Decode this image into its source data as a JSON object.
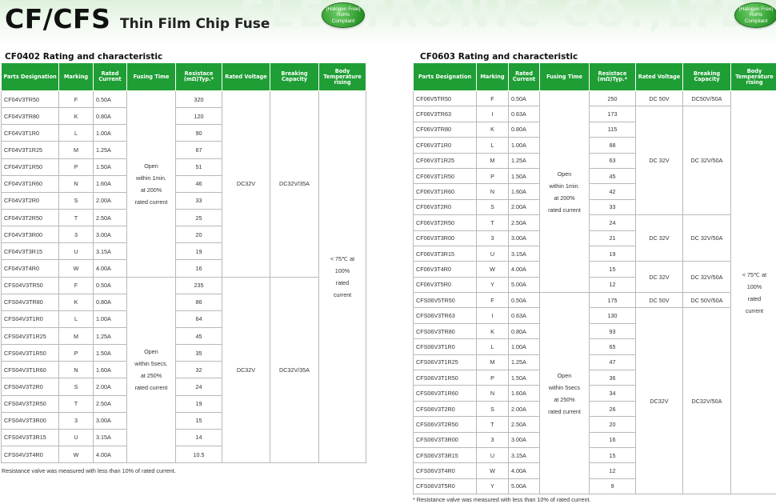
{
  "header": {
    "series": "CF/CFS",
    "subtitle": "Thin Film Chip Fuse",
    "watermark": "ELECTRONIC CO.,LTD",
    "badge": [
      "(Halogen Free)",
      "RoHs",
      "Compliant"
    ]
  },
  "columns": [
    "Parts Designation",
    "Marking",
    "Rated Current",
    "Fusing Time",
    "Resistace (mΩ)Typ.*",
    "Rated Voltage",
    "Breaking Capacity",
    "Body Temperature rising"
  ],
  "left": {
    "title": "CF0402 Rating and characteristic",
    "rows": [
      [
        "CF04V3TR50",
        "F",
        "0.50A",
        "320"
      ],
      [
        "CF04V3TR80",
        "K",
        "0.80A",
        "120"
      ],
      [
        "CF04V3T1R0",
        "L",
        "1.00A",
        "90"
      ],
      [
        "CF04V3T1R25",
        "M",
        "1.25A",
        "67"
      ],
      [
        "CF04V3T1R50",
        "P",
        "1.50A",
        "51"
      ],
      [
        "CF04V3T1R60",
        "N",
        "1.60A",
        "46"
      ],
      [
        "CF04V3T2R0",
        "S",
        "2.00A",
        "33"
      ],
      [
        "CF04V3T2R50",
        "T",
        "2.50A",
        "25"
      ],
      [
        "CF04V3T3R00",
        "3",
        "3.00A",
        "20"
      ],
      [
        "CF04V3T3R15",
        "U",
        "3.15A",
        "19"
      ],
      [
        "CF04V3T4R0",
        "W",
        "4.00A",
        "16"
      ],
      [
        "CFS04V3TR50",
        "F",
        "0.50A",
        "235"
      ],
      [
        "CFS04V3TR80",
        "K",
        "0.80A",
        "86"
      ],
      [
        "CFS04V3T1R0",
        "L",
        "1.00A",
        "64"
      ],
      [
        "CFS04V3T1R25",
        "M",
        "1.25A",
        "45"
      ],
      [
        "CFS04V3T1R50",
        "P",
        "1.50A",
        "35"
      ],
      [
        "CFS04V3T1R60",
        "N",
        "1.60A",
        "32"
      ],
      [
        "CFS04V3T2R0",
        "S",
        "2.00A",
        "24"
      ],
      [
        "CFS04V3T2R50",
        "T",
        "2.50A",
        "19"
      ],
      [
        "CFS04V3T3R00",
        "3",
        "3.00A",
        "15"
      ],
      [
        "CFS04V3T3R15",
        "U",
        "3.15A",
        "14"
      ],
      [
        "CFS04V3T4R0",
        "W",
        "4.00A",
        "10.5"
      ]
    ],
    "fusing_cf": [
      "Open",
      "within 1min.",
      "at 200%",
      "rated current"
    ],
    "fusing_cfs": [
      "Open",
      "within 5secs.",
      "at 250%",
      "rated current"
    ],
    "voltage_cf": "DC32V",
    "breaking_cf": "DC32V/35A",
    "voltage_cfs": "DC32V",
    "breaking_cfs": "DC32V/35A",
    "temperature": [
      "< 75℃ at",
      "100%",
      "rated",
      "current"
    ],
    "note": "Resistance valve was measured with less than 10% of rated current."
  },
  "right": {
    "title": "CF0603 Rating and characteristic",
    "rows": [
      [
        "CF06V5TR50",
        "F",
        "0.50A",
        "250"
      ],
      [
        "CF06V3TR63",
        "I",
        "0.63A",
        "173"
      ],
      [
        "CF06V3TR80",
        "K",
        "0.80A",
        "115"
      ],
      [
        "CF06V3T1R0",
        "L",
        "1.00A",
        "88"
      ],
      [
        "CF06V3T1R25",
        "M",
        "1.25A",
        "63"
      ],
      [
        "CF06V3T1R50",
        "P",
        "1.50A",
        "45"
      ],
      [
        "CF06V3T1R60",
        "N",
        "1.60A",
        "42"
      ],
      [
        "CF06V3T2R0",
        "S",
        "2.00A",
        "33"
      ],
      [
        "CF06V3T2R50",
        "T",
        "2.50A",
        "24"
      ],
      [
        "CF06V3T3R00",
        "3",
        "3.00A",
        "21"
      ],
      [
        "CF06V3T3R15",
        "U",
        "3.15A",
        "19"
      ],
      [
        "CF06V3T4R0",
        "W",
        "4.00A",
        "15"
      ],
      [
        "CF06V3T5R0",
        "Y",
        "5.00A",
        "12"
      ],
      [
        "CFS06V5TR50",
        "F",
        "0.50A",
        "175"
      ],
      [
        "CFS06V3TR63",
        "I",
        "0.63A",
        "130"
      ],
      [
        "CFS06V3TR80",
        "K",
        "0.80A",
        "93"
      ],
      [
        "CFS06V3T1R0",
        "L",
        "1.00A",
        "65"
      ],
      [
        "CFS06V3T1R25",
        "M",
        "1.25A",
        "47"
      ],
      [
        "CFS06V3T1R50",
        "P",
        "1.50A",
        "36"
      ],
      [
        "CFS06V3T1R60",
        "N",
        "1.60A",
        "34"
      ],
      [
        "CFS06V3T2R0",
        "S",
        "2.00A",
        "26"
      ],
      [
        "CFS06V3T2R50",
        "T",
        "2.50A",
        "20"
      ],
      [
        "CFS06V3T3R00",
        "3",
        "3.00A",
        "16"
      ],
      [
        "CFS06V3T3R15",
        "U",
        "3.15A",
        "15"
      ],
      [
        "CFS06V3T4R0",
        "W",
        "4.00A",
        "12"
      ],
      [
        "CFS06V3T5R0",
        "Y",
        "5.00A",
        "9"
      ]
    ],
    "fusing_cf": [
      "Open",
      "within 1min.",
      "at 200%",
      "rated current"
    ],
    "fusing_cfs": [
      "Open",
      "within 5secs",
      "at 250%",
      "rated current"
    ],
    "groups": [
      {
        "voltage": "DC 50V",
        "breaking": "DC50V/50A"
      },
      {
        "voltage": "DC 32V",
        "breaking": "DC 32V/50A"
      },
      {
        "voltage": "DC 32V",
        "breaking": "DC 32V/50A"
      },
      {
        "voltage": "DC 32V",
        "breaking": "DC 32V/50A"
      },
      {
        "voltage": "DC 50V",
        "breaking": "DC 50V/50A"
      },
      {
        "voltage": "DC32V",
        "breaking": "DC32V/50A"
      }
    ],
    "temperature": [
      "< 75℃ at",
      "100%",
      "rated",
      "current"
    ],
    "note": "* Resistance valve was measured with less than 10% of rated current."
  },
  "colors": {
    "header_green": "#1f9e35",
    "badge_green": "#2f9a2d"
  }
}
